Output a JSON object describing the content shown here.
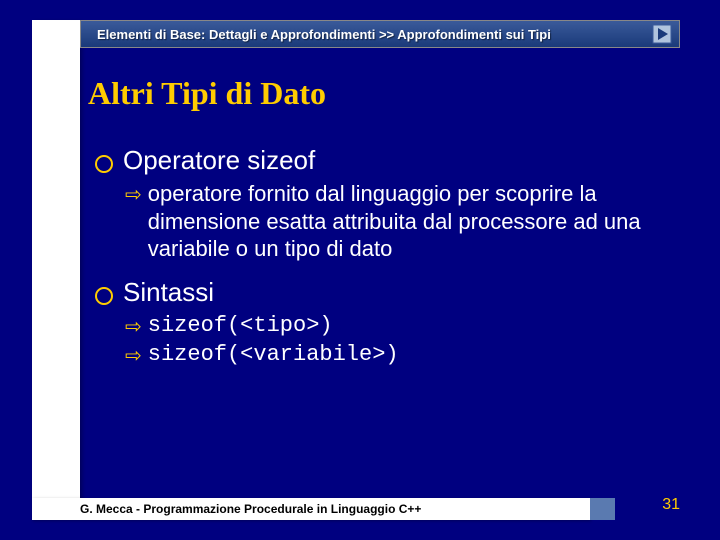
{
  "breadcrumb": "Elementi di Base: Dettagli e Approfondimenti >> Approfondimenti sui Tipi",
  "title": "Altri Tipi di Dato",
  "section1": {
    "heading": "Operatore sizeof",
    "sub": "operatore fornito dal linguaggio per scoprire la dimensione esatta attribuita dal processore ad una variabile o un tipo di dato"
  },
  "section2": {
    "heading": "Sintassi",
    "line1": "sizeof(<tipo>)",
    "line2": "sizeof(<variabile>)"
  },
  "footer": "G. Mecca - Programmazione Procedurale in Linguaggio C++",
  "page": "31"
}
